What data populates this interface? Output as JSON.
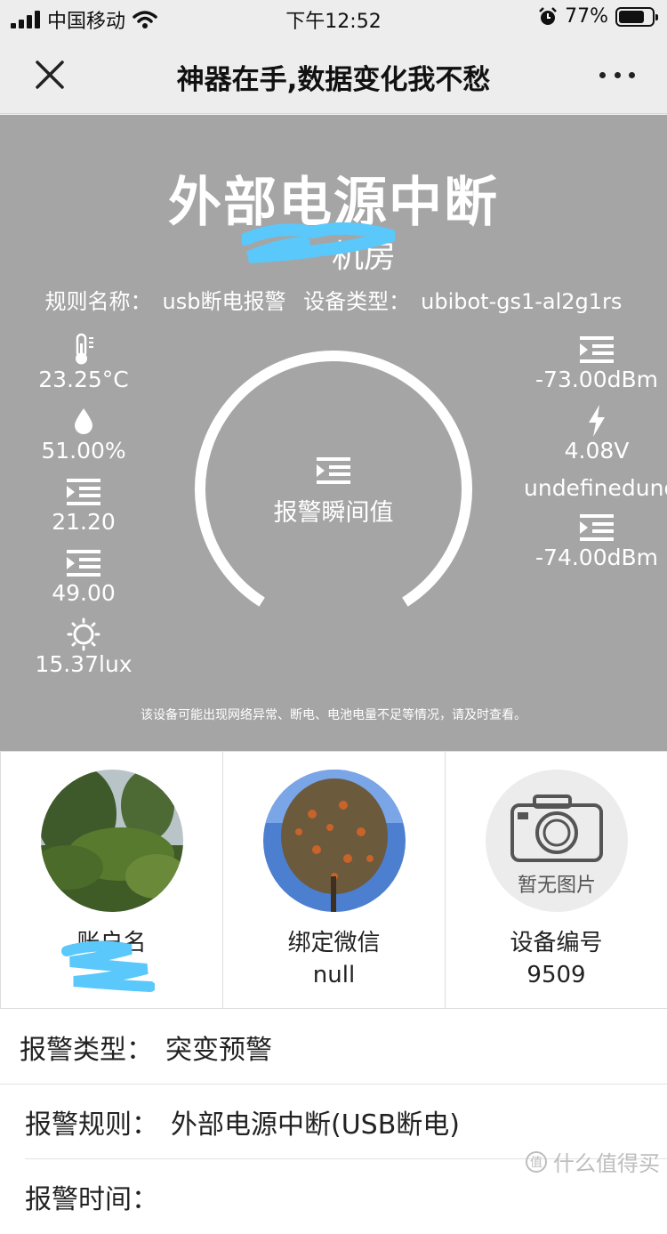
{
  "status_bar": {
    "carrier": "中国移动",
    "time": "下午12:52",
    "battery": "77%",
    "battery_level": 0.77
  },
  "nav": {
    "title": "神器在手,数据变化我不愁",
    "close_icon": "close-icon",
    "more_icon": "more-icon"
  },
  "alert": {
    "title": "外部电源中断",
    "room": "机房",
    "rule_label": "规则名称：",
    "rule_value": "usb断电报警",
    "device_type_label": "设备类型：",
    "device_type_value": "ubibot-gs1-al2g1rs",
    "gauge_label": "报警瞬间值",
    "gauge_fraction": 0.82,
    "notice": "该设备可能出现网络异常、断电、电池电量不足等情况，请及时查看。",
    "panel_color": "#a5a5a5"
  },
  "metrics_left": [
    {
      "icon": "thermometer-icon",
      "value": "23.25°C"
    },
    {
      "icon": "humidity-drop-icon",
      "value": "51.00%"
    },
    {
      "icon": "generic-list-icon",
      "value": "21.20"
    },
    {
      "icon": "generic-list-icon",
      "value": "49.00"
    },
    {
      "icon": "sun-icon",
      "value": "15.37lux"
    }
  ],
  "metrics_right": [
    {
      "icon": "generic-list-icon",
      "value": "-73.00dBm"
    },
    {
      "icon": "lightning-icon",
      "value": "4.08V"
    },
    {
      "icon": "none",
      "value": "undefinedundefined"
    },
    {
      "icon": "generic-list-icon",
      "value": "-74.00dBm"
    }
  ],
  "cards": [
    {
      "label": "账户名",
      "value": ""
    },
    {
      "label": "绑定微信",
      "value": "null"
    },
    {
      "label": "设备编号",
      "value": "9509",
      "no_image_text": "暂无图片"
    }
  ],
  "details": [
    {
      "key": "报警类型：",
      "value": "突变预警"
    },
    {
      "key": "报警规则：",
      "value": "外部电源中断(USB断电)"
    },
    {
      "key": "报警时间：",
      "value": ""
    }
  ],
  "watermark": "什么值得买"
}
